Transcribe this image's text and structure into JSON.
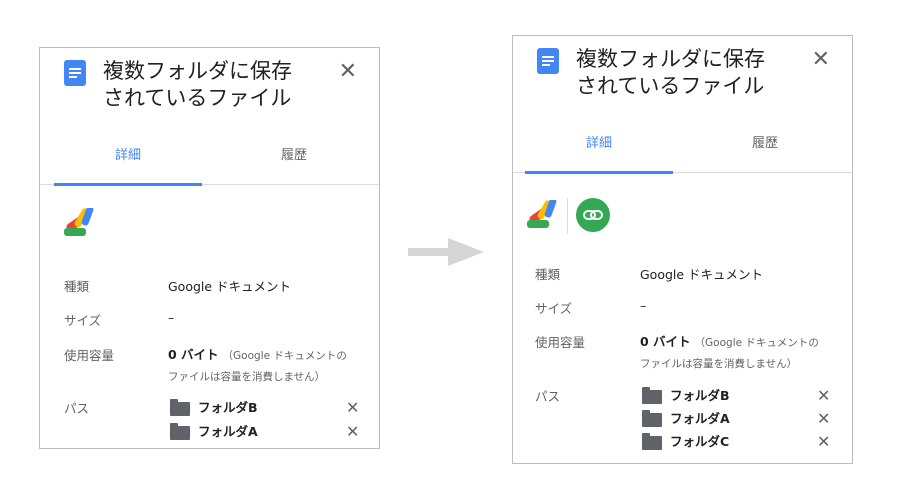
{
  "panels": [
    {
      "title_line1": "複数フォルダに保存",
      "title_line2": "されているファイル",
      "close": "✕",
      "tabs": [
        {
          "label": "詳細"
        },
        {
          "label": "履歴"
        }
      ],
      "details": {
        "type_label": "種類",
        "type_value": "Google ドキュメント",
        "size_label": "サイズ",
        "size_value": "–",
        "usage_label": "使用容量",
        "usage_value": "0 バイト",
        "usage_note_1": "（Google ドキュメントの",
        "usage_note_2": "ファイルは容量を消費しません）",
        "path_label": "パス"
      },
      "folders": [
        {
          "name": "フォルダB",
          "remove": "✕"
        },
        {
          "name": "フォルダA",
          "remove": "✕"
        }
      ]
    },
    {
      "title_line1": "複数フォルダに保存",
      "title_line2": "されているファイル",
      "close": "✕",
      "tabs": [
        {
          "label": "詳細"
        },
        {
          "label": "履歴"
        }
      ],
      "details": {
        "type_label": "種類",
        "type_value": "Google ドキュメント",
        "size_label": "サイズ",
        "size_value": "–",
        "usage_label": "使用容量",
        "usage_value": "0 バイト",
        "usage_note_1": "（Google ドキュメントの",
        "usage_note_2": "ファイルは容量を消費しません）",
        "path_label": "パス"
      },
      "folders": [
        {
          "name": "フォルダB",
          "remove": "✕"
        },
        {
          "name": "フォルダA",
          "remove": "✕"
        },
        {
          "name": "フォルダC",
          "remove": "✕"
        }
      ]
    }
  ],
  "icons": {
    "doc": "google-docs-icon",
    "app_script": "apps-script-icon",
    "link": "link-icon",
    "arrow": "right-arrow-icon"
  },
  "colors": {
    "accent_blue": "#4285f4",
    "link_green": "#34a853",
    "arrow_gray": "#d6d6d6"
  }
}
